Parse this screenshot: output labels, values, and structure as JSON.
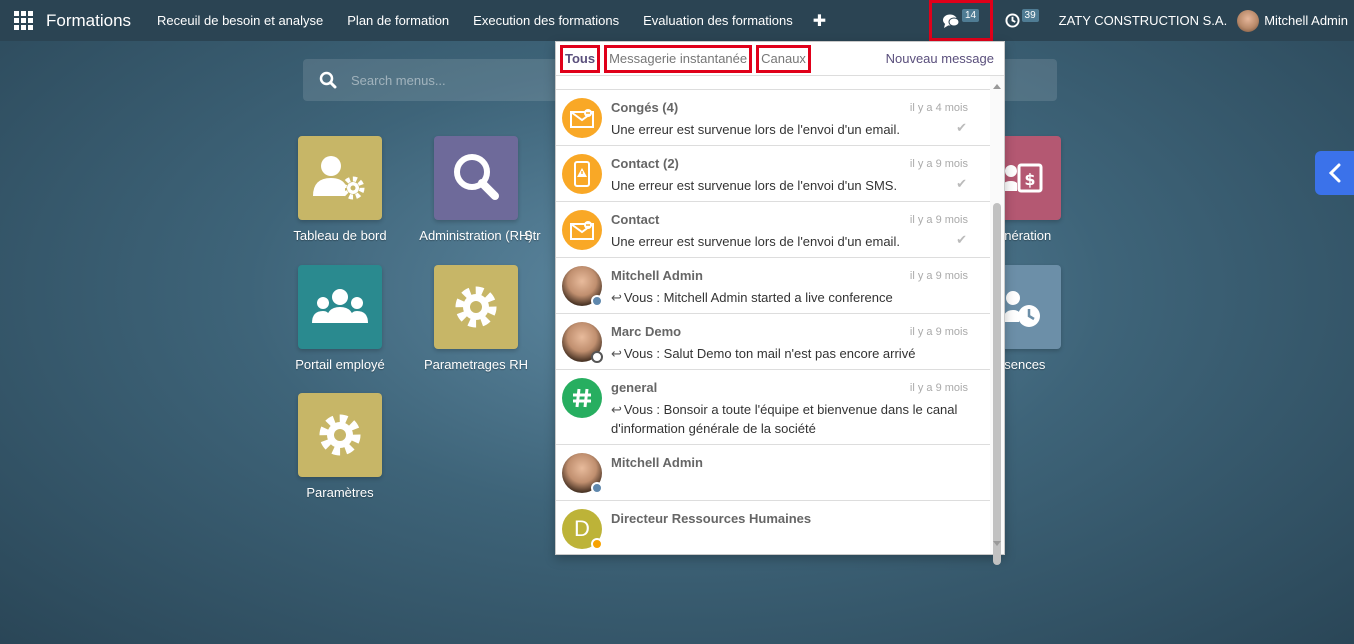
{
  "navbar": {
    "brand": "Formations",
    "menu": [
      "Receuil de besoin et analyse",
      "Plan de formation",
      "Execution des formations",
      "Evaluation des formations"
    ],
    "chat_badge": "14",
    "activity_badge": "39",
    "company": "ZATY CONSTRUCTION S.A.",
    "user": "Mitchell Admin"
  },
  "search": {
    "placeholder": "Search menus..."
  },
  "apps": [
    {
      "label": "Tableau de bord",
      "color": "#c7b667"
    },
    {
      "label": "Administration (RH)",
      "color": "#6e6a9a"
    },
    {
      "label": "Str",
      "color": "#6e6a9a"
    },
    {
      "label": "Portail employé",
      "color": "#2a8a8f"
    },
    {
      "label": "Parametrages RH",
      "color": "#c7b667"
    },
    {
      "label": "Paramètres",
      "color": "#c7b667"
    },
    {
      "label": "unération",
      "color": "#b45872"
    },
    {
      "label": "ésences",
      "color": "#6c8fa8"
    }
  ],
  "messaging": {
    "filters": [
      "Tous",
      "Messagerie instantanée",
      "Canaux"
    ],
    "new_message": "Nouveau message",
    "previews": [
      {
        "title": "Congés (4)",
        "date": "il y a 4 mois",
        "message": "Une erreur est survenue lors de l'envoi d'un email.",
        "icon": "envelope-error-icon"
      },
      {
        "title": "Contact (2)",
        "date": "il y a 9 mois",
        "message": "Une erreur est survenue lors de l'envoi d'un SMS.",
        "icon": "phone-warning-icon"
      },
      {
        "title": "Contact",
        "date": "il y a 9 mois",
        "message": "Une erreur est survenue lors de l'envoi d'un email.",
        "icon": "envelope-error-icon"
      },
      {
        "title": "Mitchell Admin",
        "date": "il y a 9 mois",
        "message": "Vous : Mitchell Admin started a live conference"
      },
      {
        "title": "Marc Demo",
        "date": "il y a 9 mois",
        "message": "Vous : Salut Demo ton mail n'est pas encore arrivé"
      },
      {
        "title": "general",
        "date": "il y a 9 mois",
        "message": "Vous : Bonsoir a toute l'équipe et bienvenue dans le canal d'information générale de la société"
      },
      {
        "title": "Mitchell Admin",
        "date": "",
        "message": ""
      },
      {
        "title": "Directeur Ressources Humaines",
        "date": "",
        "message": "",
        "initial": "D"
      }
    ]
  }
}
